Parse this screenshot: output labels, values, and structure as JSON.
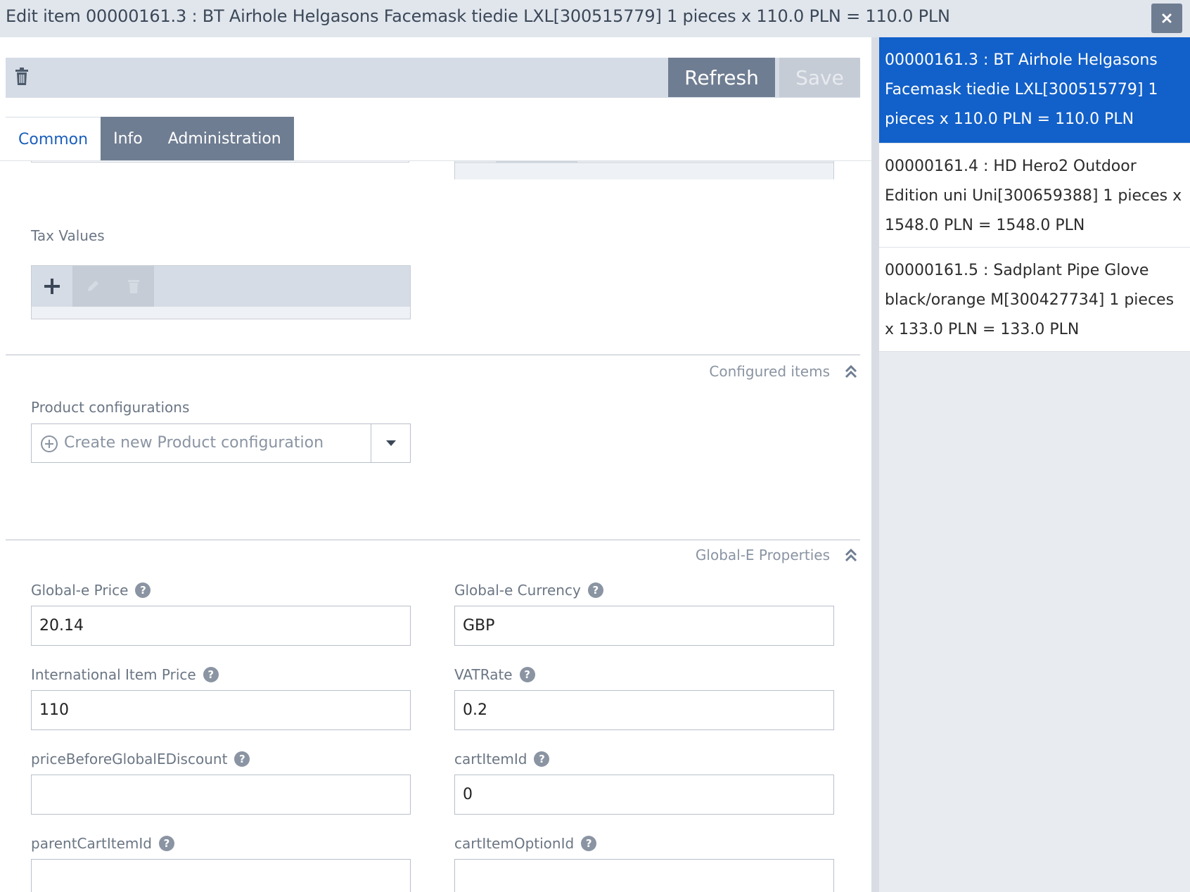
{
  "window": {
    "title": "Edit item 00000161.3 : BT Airhole Helgasons Facemask tiedie LXL[300515779] 1 pieces x 110.0 PLN = 110.0 PLN"
  },
  "toolbar": {
    "refresh_label": "Refresh",
    "save_label": "Save"
  },
  "tabs": [
    {
      "label": "Common",
      "active": true
    },
    {
      "label": "Info",
      "active": false
    },
    {
      "label": "Administration",
      "active": false
    }
  ],
  "tax_values": {
    "label": "Tax Values"
  },
  "configured_items": {
    "section_title": "Configured items",
    "product_configurations_label": "Product configurations",
    "combo_placeholder": "Create new Product configuration"
  },
  "global_e": {
    "section_title": "Global-E Properties",
    "fields": {
      "global_e_price": {
        "label": "Global-e Price",
        "value": "20.14"
      },
      "global_e_currency": {
        "label": "Global-e Currency",
        "value": "GBP"
      },
      "international_item_price": {
        "label": "International Item Price",
        "value": "110"
      },
      "vat_rate": {
        "label": "VATRate",
        "value": "0.2"
      },
      "price_before_discount": {
        "label": "priceBeforeGlobalEDiscount",
        "value": ""
      },
      "cart_item_id": {
        "label": "cartItemId",
        "value": "0"
      },
      "parent_cart_item_id": {
        "label": "parentCartItemId",
        "value": ""
      },
      "cart_item_option_id": {
        "label": "cartItemOptionId",
        "value": ""
      }
    }
  },
  "sidebar": {
    "items": [
      {
        "label": "00000161.3 : BT Airhole Helgasons Facemask tiedie LXL[300515779] 1 pieces x 110.0 PLN = 110.0 PLN",
        "active": true
      },
      {
        "label": "00000161.4 : HD Hero2 Outdoor Edition uni Uni[300659388] 1 pieces x 1548.0 PLN = 1548.0 PLN",
        "active": false
      },
      {
        "label": "00000161.5 : Sadplant Pipe Glove black/orange M[300427734] 1 pieces x 133.0 PLN = 133.0 PLN",
        "active": false
      }
    ]
  },
  "colors": {
    "accent": "#1260c9",
    "toolbar_button": "#6f7d92",
    "titlebar": "#e1e6ed"
  },
  "icons": [
    "close-icon",
    "trash-icon",
    "plus-icon",
    "pencil-icon",
    "chevron-up-double-icon",
    "plus-circle-icon",
    "caret-down-icon",
    "help-icon"
  ]
}
